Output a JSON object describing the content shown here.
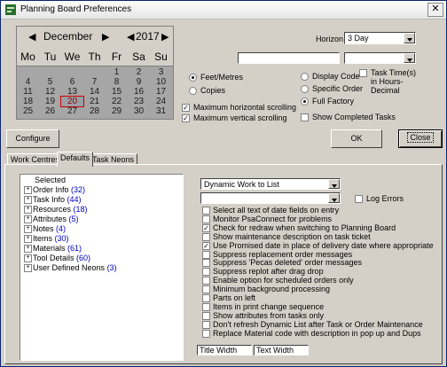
{
  "window": {
    "title": "Planning Board Preferences",
    "close_glyph": "✕"
  },
  "calendar": {
    "month": "December",
    "year": "2017",
    "prev_glyph": "◀",
    "next_glyph": "▶",
    "day_names": [
      "Mo",
      "Tu",
      "We",
      "Th",
      "Fr",
      "Sa",
      "Su"
    ],
    "weeks": [
      [
        "",
        "",
        "",
        "",
        "1",
        "2",
        "3"
      ],
      [
        "4",
        "5",
        "6",
        "7",
        "8",
        "9",
        "10"
      ],
      [
        "11",
        "12",
        "13",
        "14",
        "15",
        "16",
        "17"
      ],
      [
        "18",
        "19",
        "20",
        "21",
        "22",
        "23",
        "24"
      ],
      [
        "25",
        "26",
        "27",
        "28",
        "29",
        "30",
        "31"
      ]
    ],
    "selected_day": "20"
  },
  "horizon": {
    "label": "Horizon",
    "value": "3  Day"
  },
  "top_fields": {
    "text_value": "",
    "combo_value": ""
  },
  "units": {
    "feet_metres": "Feet/Metres",
    "copies": "Copies",
    "selected": "feet_metres"
  },
  "scrolling": {
    "max_horizontal": {
      "label": "Maximum horizontal scrolling",
      "checked": true
    },
    "max_vertical": {
      "label": "Maximum vertical scrolling",
      "checked": true
    }
  },
  "display_mode": {
    "display_code": "Display Code",
    "specific_order": "Specific Order",
    "full_factory": "Full Factory",
    "selected": "full_factory"
  },
  "task_times": {
    "label": "Task Time(s) in Hours-Decimal",
    "checked": false
  },
  "show_completed": {
    "label": "Show Completed Tasks",
    "checked": false
  },
  "buttons": {
    "configure": "Configure",
    "ok": "OK",
    "close": "Close"
  },
  "tabs": [
    {
      "label": "Work Centres",
      "active": false
    },
    {
      "label": "Defaults",
      "active": true
    },
    {
      "label": "Task Neons",
      "active": false
    }
  ],
  "tree": {
    "root": "Selected",
    "items": [
      {
        "label": "Order Info",
        "count": "(32)"
      },
      {
        "label": "Task Info",
        "count": "(44)"
      },
      {
        "label": "Resources",
        "count": "(18)"
      },
      {
        "label": "Attributes",
        "count": "(5)"
      },
      {
        "label": "Notes",
        "count": "(4)"
      },
      {
        "label": "Items",
        "count": "(30)"
      },
      {
        "label": "Materials",
        "count": "(61)"
      },
      {
        "label": "Tool Details",
        "count": "(60)"
      },
      {
        "label": "User Defined Neons",
        "count": "(3)"
      }
    ]
  },
  "defaults": {
    "dynamic_combo": "Dynamic Work to List",
    "second_combo": "",
    "log_errors": {
      "label": "Log Errors",
      "checked": false
    },
    "options": [
      {
        "label": "Select all text of date fields on entry",
        "checked": false
      },
      {
        "label": "Monitor PsaConnect for problems",
        "checked": false
      },
      {
        "label": "Check for redraw when switching to Planning Board",
        "checked": true
      },
      {
        "label": "Show maintenance description on task ticket",
        "checked": false
      },
      {
        "label": "Use Promised date in place of delivery date where appropriate",
        "checked": true
      },
      {
        "label": "Suppress replacement order messages",
        "checked": false
      },
      {
        "label": "Suppress 'Pecas deleted' order messages",
        "checked": false
      },
      {
        "label": "Suppress replot after drag drop",
        "checked": false
      },
      {
        "label": "Enable option for scheduled orders only",
        "checked": false
      },
      {
        "label": "Minimum background processing",
        "checked": false
      },
      {
        "label": "Parts on left",
        "checked": false
      },
      {
        "label": "Items in print change sequence",
        "checked": false
      },
      {
        "label": "Show attributes from tasks only",
        "checked": false
      },
      {
        "label": "Don't refresh Dynamic List after Task or Order Maintenance",
        "checked": false
      },
      {
        "label": "Replace Material code with description in pop up and Dups",
        "checked": false
      }
    ],
    "title_width": "Title Width",
    "text_width": "Text Width"
  },
  "colors": {
    "tree_count": "#0000c0",
    "selected_day_border": "#cc0000"
  }
}
